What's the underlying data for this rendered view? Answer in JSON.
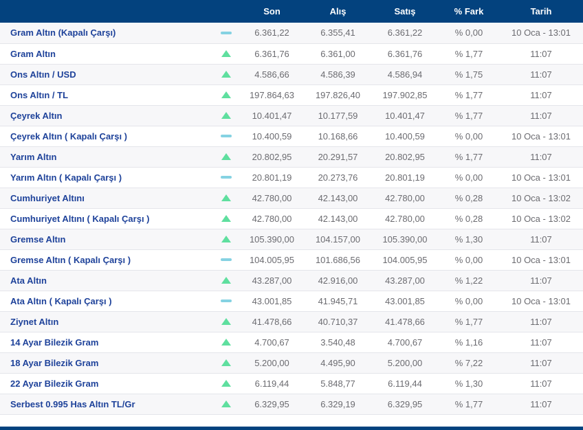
{
  "colors": {
    "header_bg": "#03427e",
    "header_text": "#ffffff",
    "row_bg": "#ffffff",
    "row_alt_bg": "#f7f7f9",
    "divider": "#e4e5ea",
    "name_text": "#1e429a",
    "value_text": "#6b6b70",
    "trend_up": "#5fdf9f",
    "trend_flat": "#85d2e2"
  },
  "table": {
    "header": {
      "son": "Son",
      "alis": "Alış",
      "satis": "Satış",
      "fark": "% Fark",
      "tarih": "Tarih"
    },
    "rows": [
      {
        "name": "Gram Altın (Kapalı Çarşı)",
        "trend": "flat",
        "son": "6.361,22",
        "alis": "6.355,41",
        "satis": "6.361,22",
        "fark": "% 0,00",
        "tarih": "10 Oca - 13:01"
      },
      {
        "name": "Gram Altın",
        "trend": "up",
        "son": "6.361,76",
        "alis": "6.361,00",
        "satis": "6.361,76",
        "fark": "% 1,77",
        "tarih": "11:07"
      },
      {
        "name": "Ons Altın / USD",
        "trend": "up",
        "son": "4.586,66",
        "alis": "4.586,39",
        "satis": "4.586,94",
        "fark": "% 1,75",
        "tarih": "11:07"
      },
      {
        "name": "Ons Altın / TL",
        "trend": "up",
        "son": "197.864,63",
        "alis": "197.826,40",
        "satis": "197.902,85",
        "fark": "% 1,77",
        "tarih": "11:07"
      },
      {
        "name": "Çeyrek Altın",
        "trend": "up",
        "son": "10.401,47",
        "alis": "10.177,59",
        "satis": "10.401,47",
        "fark": "% 1,77",
        "tarih": "11:07"
      },
      {
        "name": "Çeyrek Altın ( Kapalı Çarşı )",
        "trend": "flat",
        "son": "10.400,59",
        "alis": "10.168,66",
        "satis": "10.400,59",
        "fark": "% 0,00",
        "tarih": "10 Oca - 13:01"
      },
      {
        "name": "Yarım Altın",
        "trend": "up",
        "son": "20.802,95",
        "alis": "20.291,57",
        "satis": "20.802,95",
        "fark": "% 1,77",
        "tarih": "11:07"
      },
      {
        "name": "Yarım Altın ( Kapalı Çarşı )",
        "trend": "flat",
        "son": "20.801,19",
        "alis": "20.273,76",
        "satis": "20.801,19",
        "fark": "% 0,00",
        "tarih": "10 Oca - 13:01"
      },
      {
        "name": "Cumhuriyet Altını",
        "trend": "up",
        "son": "42.780,00",
        "alis": "42.143,00",
        "satis": "42.780,00",
        "fark": "% 0,28",
        "tarih": "10 Oca - 13:02"
      },
      {
        "name": "Cumhuriyet Altını ( Kapalı Çarşı )",
        "trend": "up",
        "son": "42.780,00",
        "alis": "42.143,00",
        "satis": "42.780,00",
        "fark": "% 0,28",
        "tarih": "10 Oca - 13:02"
      },
      {
        "name": "Gremse Altın",
        "trend": "up",
        "son": "105.390,00",
        "alis": "104.157,00",
        "satis": "105.390,00",
        "fark": "% 1,30",
        "tarih": "11:07"
      },
      {
        "name": "Gremse Altın ( Kapalı Çarşı )",
        "trend": "flat",
        "son": "104.005,95",
        "alis": "101.686,56",
        "satis": "104.005,95",
        "fark": "% 0,00",
        "tarih": "10 Oca - 13:01"
      },
      {
        "name": "Ata Altın",
        "trend": "up",
        "son": "43.287,00",
        "alis": "42.916,00",
        "satis": "43.287,00",
        "fark": "% 1,22",
        "tarih": "11:07"
      },
      {
        "name": "Ata Altın ( Kapalı Çarşı )",
        "trend": "flat",
        "son": "43.001,85",
        "alis": "41.945,71",
        "satis": "43.001,85",
        "fark": "% 0,00",
        "tarih": "10 Oca - 13:01"
      },
      {
        "name": "Ziynet Altın",
        "trend": "up",
        "son": "41.478,66",
        "alis": "40.710,37",
        "satis": "41.478,66",
        "fark": "% 1,77",
        "tarih": "11:07"
      },
      {
        "name": "14 Ayar Bilezik Gram",
        "trend": "up",
        "son": "4.700,67",
        "alis": "3.540,48",
        "satis": "4.700,67",
        "fark": "% 1,16",
        "tarih": "11:07"
      },
      {
        "name": "18 Ayar Bilezik Gram",
        "trend": "up",
        "son": "5.200,00",
        "alis": "4.495,90",
        "satis": "5.200,00",
        "fark": "% 7,22",
        "tarih": "11:07"
      },
      {
        "name": "22 Ayar Bilezik Gram",
        "trend": "up",
        "son": "6.119,44",
        "alis": "5.848,77",
        "satis": "6.119,44",
        "fark": "% 1,30",
        "tarih": "11:07"
      },
      {
        "name": "Serbest 0.995 Has Altın TL/Gr",
        "trend": "up",
        "son": "6.329,95",
        "alis": "6.329,19",
        "satis": "6.329,95",
        "fark": "% 1,77",
        "tarih": "11:07"
      }
    ]
  }
}
